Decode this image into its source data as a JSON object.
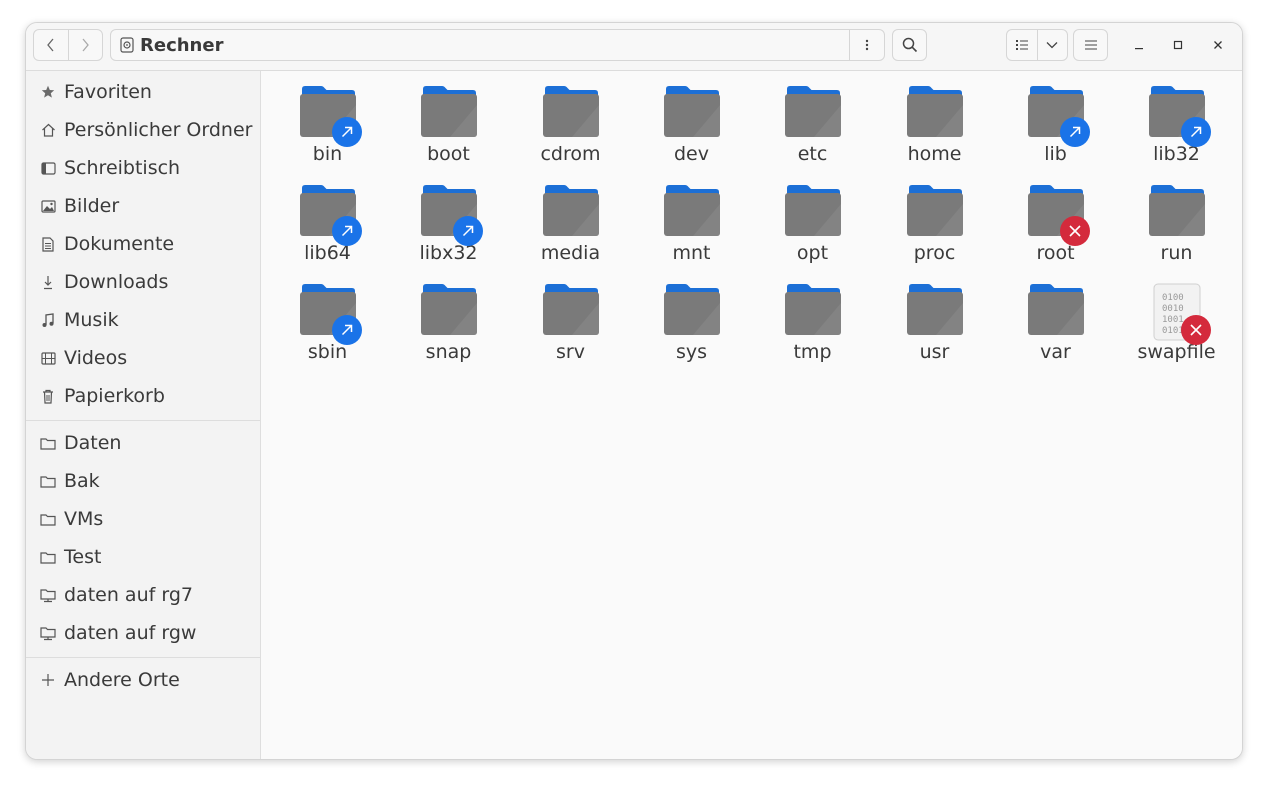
{
  "window": {
    "location": "Rechner"
  },
  "sidebar": {
    "places": [
      {
        "label": "Favoriten",
        "icon": "star-icon"
      },
      {
        "label": "Persönlicher Ordner",
        "icon": "home-icon"
      },
      {
        "label": "Schreibtisch",
        "icon": "desktop-icon"
      },
      {
        "label": "Bilder",
        "icon": "image-icon"
      },
      {
        "label": "Dokumente",
        "icon": "document-icon"
      },
      {
        "label": "Downloads",
        "icon": "download-icon"
      },
      {
        "label": "Musik",
        "icon": "music-icon"
      },
      {
        "label": "Videos",
        "icon": "film-icon"
      },
      {
        "label": "Papierkorb",
        "icon": "trash-icon"
      }
    ],
    "bookmarks": [
      {
        "label": "Daten",
        "icon": "folder-icon"
      },
      {
        "label": "Bak",
        "icon": "folder-icon"
      },
      {
        "label": "VMs",
        "icon": "folder-icon"
      },
      {
        "label": "Test",
        "icon": "folder-icon"
      },
      {
        "label": "daten auf rg7",
        "icon": "network-folder-icon"
      },
      {
        "label": "daten auf rgw",
        "icon": "network-folder-icon"
      }
    ],
    "other": {
      "label": "Andere Orte",
      "icon": "plus-icon"
    }
  },
  "files": [
    {
      "name": "bin",
      "type": "folder",
      "emblem": "symlink"
    },
    {
      "name": "boot",
      "type": "folder",
      "emblem": ""
    },
    {
      "name": "cdrom",
      "type": "folder",
      "emblem": ""
    },
    {
      "name": "dev",
      "type": "folder",
      "emblem": ""
    },
    {
      "name": "etc",
      "type": "folder",
      "emblem": ""
    },
    {
      "name": "home",
      "type": "folder",
      "emblem": ""
    },
    {
      "name": "lib",
      "type": "folder",
      "emblem": "symlink"
    },
    {
      "name": "lib32",
      "type": "folder",
      "emblem": "symlink"
    },
    {
      "name": "lib64",
      "type": "folder",
      "emblem": "symlink"
    },
    {
      "name": "libx32",
      "type": "folder",
      "emblem": "symlink"
    },
    {
      "name": "media",
      "type": "folder",
      "emblem": ""
    },
    {
      "name": "mnt",
      "type": "folder",
      "emblem": ""
    },
    {
      "name": "opt",
      "type": "folder",
      "emblem": ""
    },
    {
      "name": "proc",
      "type": "folder",
      "emblem": ""
    },
    {
      "name": "root",
      "type": "folder",
      "emblem": "unreadable"
    },
    {
      "name": "run",
      "type": "folder",
      "emblem": ""
    },
    {
      "name": "sbin",
      "type": "folder",
      "emblem": "symlink"
    },
    {
      "name": "snap",
      "type": "folder",
      "emblem": ""
    },
    {
      "name": "srv",
      "type": "folder",
      "emblem": ""
    },
    {
      "name": "sys",
      "type": "folder",
      "emblem": ""
    },
    {
      "name": "tmp",
      "type": "folder",
      "emblem": ""
    },
    {
      "name": "usr",
      "type": "folder",
      "emblem": ""
    },
    {
      "name": "var",
      "type": "folder",
      "emblem": ""
    },
    {
      "name": "swapfile",
      "type": "binary",
      "emblem": "unreadable"
    }
  ],
  "colors": {
    "folder_tab": "#1c6fd6",
    "folder_body": "#7a7a7a",
    "symlink_emblem": "#1a73e8",
    "unreadable_emblem": "#d42a3c"
  }
}
